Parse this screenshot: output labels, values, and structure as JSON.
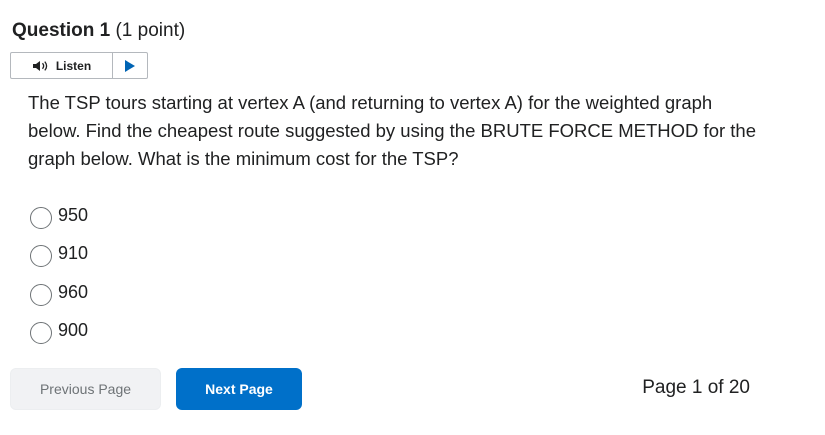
{
  "question": {
    "title": "Question 1",
    "points": "(1 point)",
    "text": "The TSP tours starting at vertex A (and returning to vertex A) for the weighted graph below. Find the cheapest route suggested by using the BRUTE FORCE METHOD for the graph below.  What is the minimum cost for the TSP?"
  },
  "listen": {
    "label": "Listen",
    "icons": {
      "speaker": "speaker-icon",
      "play": "play-icon"
    },
    "accent_color": "#0064b4"
  },
  "options": [
    {
      "label": "950",
      "selected": false
    },
    {
      "label": "910",
      "selected": false
    },
    {
      "label": "960",
      "selected": false
    },
    {
      "label": "900",
      "selected": false
    }
  ],
  "navigation": {
    "previous_label": "Previous Page",
    "next_label": "Next Page",
    "page_indicator": "Page 1 of 20",
    "next_color": "#0070c9"
  }
}
